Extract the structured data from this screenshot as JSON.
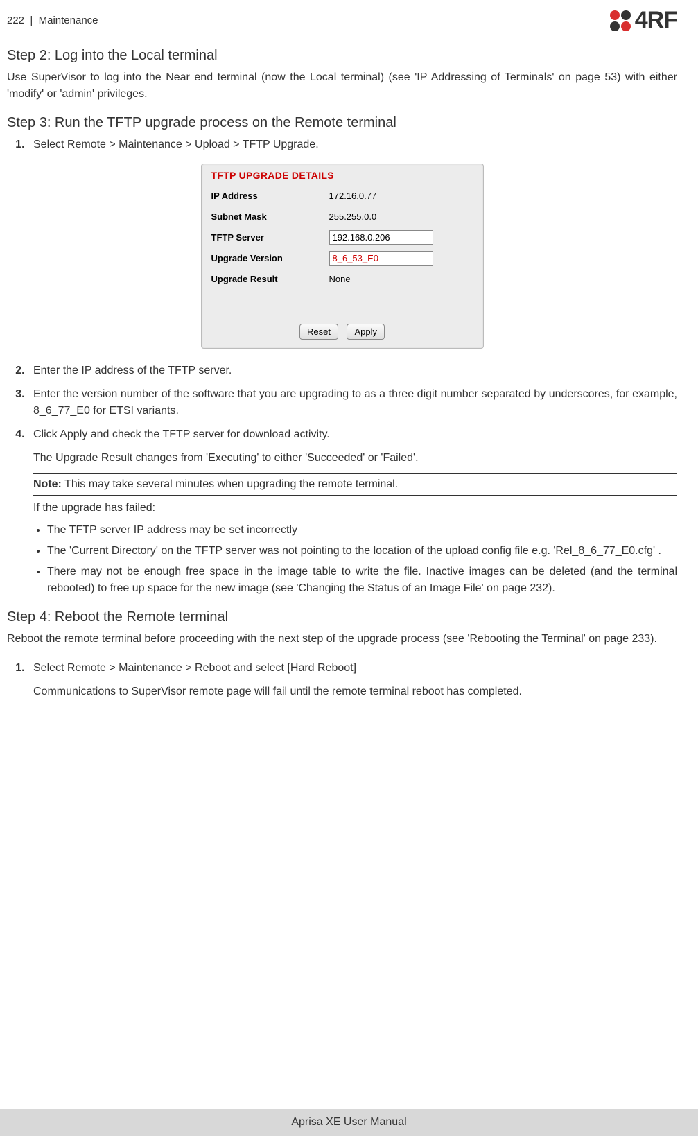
{
  "header": {
    "page_num": "222",
    "separator": "|",
    "section": "Maintenance",
    "logo_text": "4RF"
  },
  "step2": {
    "title": "Step 2: Log into the Local terminal",
    "text": "Use SuperVisor to log into the Near end terminal (now the Local terminal) (see 'IP Addressing of Terminals' on page 53) with either 'modify' or 'admin' privileges."
  },
  "step3": {
    "title": "Step 3: Run the TFTP upgrade process on the Remote terminal",
    "item1": "Select Remote > Maintenance > Upload > TFTP Upgrade.",
    "item2": "Enter the IP address of the TFTP server.",
    "item3": "Enter the version number of the software that you are upgrading to as a three digit number separated by underscores, for example, 8_6_77_E0 for ETSI variants.",
    "item4": "Click Apply and check the TFTP server for download activity.",
    "item4_sub": "The Upgrade Result changes from 'Executing' to either 'Succeeded' or 'Failed'.",
    "note_label": "Note:",
    "note_text": " This may take several minutes when upgrading the remote terminal.",
    "failed_intro": "If the upgrade has failed:",
    "bullets": [
      "The TFTP server IP address may be set incorrectly",
      "The 'Current Directory' on the TFTP server was not pointing to the location of the upload config file e.g. 'Rel_8_6_77_E0.cfg' .",
      "There may not be enough free space in the image table to write the file. Inactive images can be deleted (and the terminal rebooted) to free up space for the new image (see 'Changing the Status of an Image File' on page 232)."
    ]
  },
  "panel": {
    "title": "TFTP UPGRADE DETAILS",
    "rows": {
      "ip_label": "IP Address",
      "ip_value": "172.16.0.77",
      "subnet_label": "Subnet Mask",
      "subnet_value": "255.255.0.0",
      "server_label": "TFTP Server",
      "server_value": "192.168.0.206",
      "version_label": "Upgrade Version",
      "version_value": "8_6_53_E0",
      "result_label": "Upgrade Result",
      "result_value": "None"
    },
    "reset_btn": "Reset",
    "apply_btn": "Apply"
  },
  "step4": {
    "title": "Step 4: Reboot the Remote terminal",
    "text": "Reboot the remote terminal before proceeding with the next step of the upgrade process (see 'Rebooting the Terminal' on page 233).",
    "item1": "Select Remote > Maintenance > Reboot and select [Hard Reboot]",
    "item1_sub": "Communications to SuperVisor remote page will fail until the remote terminal reboot has completed."
  },
  "footer": {
    "text": "Aprisa XE User Manual"
  }
}
